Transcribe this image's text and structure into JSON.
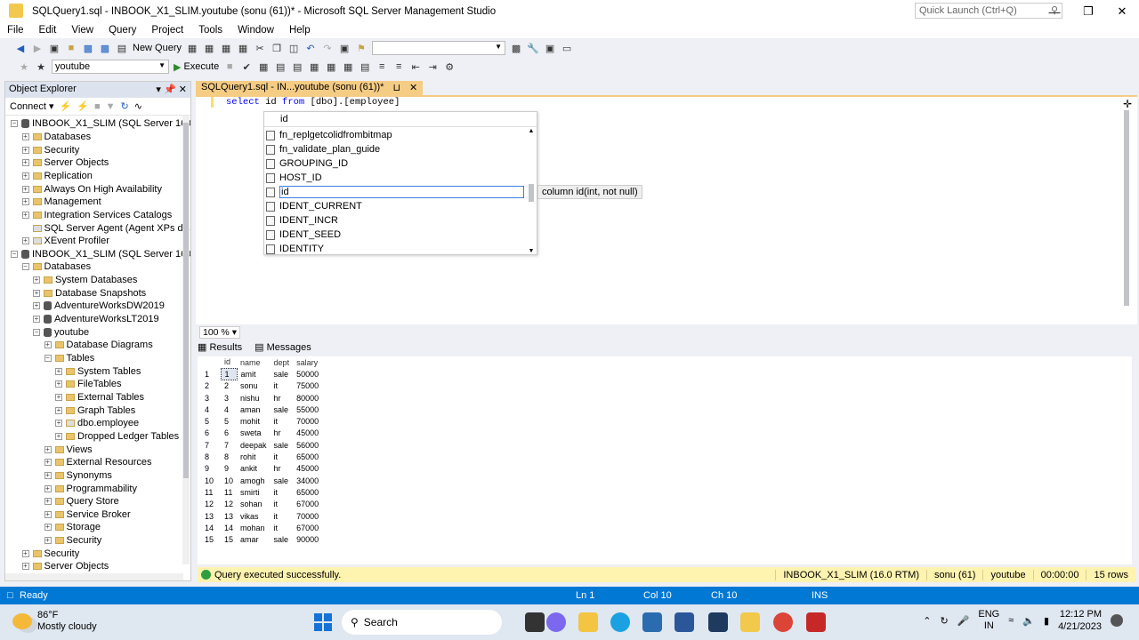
{
  "window": {
    "title": "SQLQuery1.sql - INBOOK_X1_SLIM.youtube (sonu (61))* - Microsoft SQL Server Management Studio",
    "quick_launch": "Quick Launch (Ctrl+Q)"
  },
  "menu": [
    "File",
    "Edit",
    "View",
    "Query",
    "Project",
    "Tools",
    "Window",
    "Help"
  ],
  "toolbar": {
    "new_query": "New Query",
    "database": "youtube",
    "execute": "Execute"
  },
  "object_explorer": {
    "title": "Object Explorer",
    "connect": "Connect",
    "tree": [
      {
        "label": "INBOOK_X1_SLIM (SQL Server 16.0.10",
        "level": 0,
        "exp": "-",
        "icon": "server"
      },
      {
        "label": "Databases",
        "level": 1,
        "exp": "+",
        "icon": "folder"
      },
      {
        "label": "Security",
        "level": 1,
        "exp": "+",
        "icon": "folder"
      },
      {
        "label": "Server Objects",
        "level": 1,
        "exp": "+",
        "icon": "folder"
      },
      {
        "label": "Replication",
        "level": 1,
        "exp": "+",
        "icon": "folder"
      },
      {
        "label": "Always On High Availability",
        "level": 1,
        "exp": "+",
        "icon": "folder"
      },
      {
        "label": "Management",
        "level": 1,
        "exp": "+",
        "icon": "folder"
      },
      {
        "label": "Integration Services Catalogs",
        "level": 1,
        "exp": "+",
        "icon": "folder"
      },
      {
        "label": "SQL Server Agent (Agent XPs disab",
        "level": 1,
        "exp": "",
        "icon": "agent"
      },
      {
        "label": "XEvent Profiler",
        "level": 1,
        "exp": "+",
        "icon": "xevent"
      },
      {
        "label": "INBOOK_X1_SLIM (SQL Server 16.0.10",
        "level": 0,
        "exp": "-",
        "icon": "server"
      },
      {
        "label": "Databases",
        "level": 1,
        "exp": "-",
        "icon": "folder"
      },
      {
        "label": "System Databases",
        "level": 2,
        "exp": "+",
        "icon": "folder"
      },
      {
        "label": "Database Snapshots",
        "level": 2,
        "exp": "+",
        "icon": "folder"
      },
      {
        "label": "AdventureWorksDW2019",
        "level": 2,
        "exp": "+",
        "icon": "db"
      },
      {
        "label": "AdventureWorksLT2019",
        "level": 2,
        "exp": "+",
        "icon": "db"
      },
      {
        "label": "youtube",
        "level": 2,
        "exp": "-",
        "icon": "db"
      },
      {
        "label": "Database Diagrams",
        "level": 3,
        "exp": "+",
        "icon": "folder"
      },
      {
        "label": "Tables",
        "level": 3,
        "exp": "-",
        "icon": "folder"
      },
      {
        "label": "System Tables",
        "level": 4,
        "exp": "+",
        "icon": "folder"
      },
      {
        "label": "FileTables",
        "level": 4,
        "exp": "+",
        "icon": "folder"
      },
      {
        "label": "External Tables",
        "level": 4,
        "exp": "+",
        "icon": "folder"
      },
      {
        "label": "Graph Tables",
        "level": 4,
        "exp": "+",
        "icon": "folder"
      },
      {
        "label": "dbo.employee",
        "level": 4,
        "exp": "+",
        "icon": "table"
      },
      {
        "label": "Dropped Ledger Tables",
        "level": 4,
        "exp": "+",
        "icon": "folder"
      },
      {
        "label": "Views",
        "level": 3,
        "exp": "+",
        "icon": "folder"
      },
      {
        "label": "External Resources",
        "level": 3,
        "exp": "+",
        "icon": "folder"
      },
      {
        "label": "Synonyms",
        "level": 3,
        "exp": "+",
        "icon": "folder"
      },
      {
        "label": "Programmability",
        "level": 3,
        "exp": "+",
        "icon": "folder"
      },
      {
        "label": "Query Store",
        "level": 3,
        "exp": "+",
        "icon": "folder"
      },
      {
        "label": "Service Broker",
        "level": 3,
        "exp": "+",
        "icon": "folder"
      },
      {
        "label": "Storage",
        "level": 3,
        "exp": "+",
        "icon": "folder"
      },
      {
        "label": "Security",
        "level": 3,
        "exp": "+",
        "icon": "folder"
      },
      {
        "label": "Security",
        "level": 1,
        "exp": "+",
        "icon": "folder"
      },
      {
        "label": "Server Objects",
        "level": 1,
        "exp": "+",
        "icon": "folder"
      }
    ]
  },
  "editor": {
    "tab_label": "SQLQuery1.sql - IN...youtube (sonu (61))*",
    "code_kw1": "select",
    "code_mid": " id ",
    "code_kw2": "from",
    "code_rest": " [dbo].[employee]",
    "zoom": "100 %"
  },
  "autocomplete": {
    "typed": "id",
    "items": [
      "fn_replgetcolidfrombitmap",
      "fn_validate_plan_guide",
      "GROUPING_ID",
      "HOST_ID",
      "id",
      "IDENT_CURRENT",
      "IDENT_INCR",
      "IDENT_SEED",
      "IDENTITY"
    ],
    "selected_index": 4,
    "tooltip": "column id(int, not null)"
  },
  "results": {
    "tabs": [
      "Results",
      "Messages"
    ],
    "columns": [
      "id",
      "name",
      "dept",
      "salary"
    ],
    "rows": [
      [
        "1",
        "amit",
        "sale",
        "50000"
      ],
      [
        "2",
        "sonu",
        "it",
        "75000"
      ],
      [
        "3",
        "nishu",
        "hr",
        "80000"
      ],
      [
        "4",
        "aman",
        "sale",
        "55000"
      ],
      [
        "5",
        "mohit",
        "it",
        "70000"
      ],
      [
        "6",
        "sweta",
        "hr",
        "45000"
      ],
      [
        "7",
        "deepak",
        "sale",
        "56000"
      ],
      [
        "8",
        "rohit",
        "it",
        "65000"
      ],
      [
        "9",
        "ankit",
        "hr",
        "45000"
      ],
      [
        "10",
        "amogh",
        "sale",
        "34000"
      ],
      [
        "11",
        "smirti",
        "it",
        "65000"
      ],
      [
        "12",
        "sohan",
        "it",
        "67000"
      ],
      [
        "13",
        "vikas",
        "it",
        "70000"
      ],
      [
        "14",
        "mohan",
        "it",
        "67000"
      ],
      [
        "15",
        "amar",
        "sale",
        "90000"
      ]
    ]
  },
  "query_status": {
    "message": "Query executed successfully.",
    "server": "INBOOK_X1_SLIM (16.0 RTM)",
    "user": "sonu (61)",
    "db": "youtube",
    "time": "00:00:00",
    "rows": "15 rows"
  },
  "status": {
    "ready": "Ready",
    "ln": "Ln 1",
    "col": "Col 10",
    "ch": "Ch 10",
    "ins": "INS"
  },
  "taskbar": {
    "temp": "86°F",
    "weather": "Mostly cloudy",
    "search": "Search",
    "lang1": "ENG",
    "lang2": "IN",
    "time": "12:12 PM",
    "date": "4/21/2023"
  }
}
